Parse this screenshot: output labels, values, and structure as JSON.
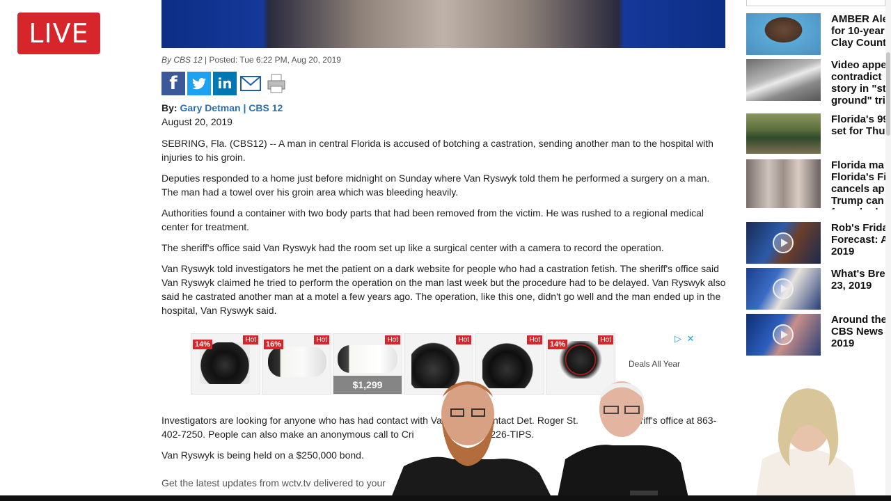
{
  "live_label": "LIVE",
  "article": {
    "meta_source": "By CBS 12",
    "meta_posted": "| Posted: Tue 6:22 PM, Aug 20, 2019",
    "by_label": "By:",
    "author": "Gary Detman | CBS 12",
    "date": "August 20, 2019",
    "paragraphs": [
      "SEBRING, Fla. (CBS12) -- A man in central Florida is accused of botching a castration, sending another man to the hospital with injuries to his groin.",
      "Deputies responded to a home just before midnight on Sunday where Van Ryswyk told them he performed a surgery on a man. The man had a towel over his groin area which was bleeding heavily.",
      "Authorities found a container with two body parts that had been removed from the victim. He was rushed to a regional medical center for treatment.",
      "The sheriff's office said Van Ryswyk had the room set up like a surgical center with a camera to record the operation.",
      "Van Ryswyk told investigators he met the patient on a dark website for people who had a castration fetish. The sheriff's office said Van Ryswyk claimed he tried to perform the operation on the man last week but the procedure had to be delayed. Van Ryswyk also said he castrated another man at a motel a few years ago. The operation, like this one, didn't go well and the man ended up in the hospital, Van Ryswyk said."
    ],
    "paragraphs_after_ad": [
      "Investigators are looking for anyone who has had contact with Va           to contact Det. Roger St.         t the sheriff's office at 863-402-7250. People can also make an anonymous call to Cri           ers at 800-226-TIPS.",
      "Van Ryswyk is being held on a $250,000 bond."
    ],
    "latest": "Get the latest updates from wctv.tv delivered to your"
  },
  "ad": {
    "hot_label": "Hot",
    "cards": [
      {
        "discount": "14%",
        "price": ""
      },
      {
        "discount": "16%",
        "price": ""
      },
      {
        "discount": "",
        "price": "$1,299"
      },
      {
        "discount": "",
        "price": ""
      },
      {
        "discount": "",
        "price": ""
      },
      {
        "discount": "14%",
        "price": ""
      }
    ],
    "deals_text": "Deals All Year",
    "adchoices_icon": "adchoices-icon",
    "close_icon": "close-icon"
  },
  "share_icons": [
    "facebook-icon",
    "twitter-icon",
    "linkedin-icon",
    "email-icon",
    "print-icon"
  ],
  "sidebar": [
    {
      "title": "AMBER Ale for 10-year Clay Count",
      "video": false
    },
    {
      "title": "Video appe contradict story in \"st ground\" tri",
      "video": false
    },
    {
      "title": "Florida's 99 set for Thu",
      "video": false
    },
    {
      "title": "Florida ma Florida's Fi cancels ap Trump can for schedu",
      "video": false
    },
    {
      "title": "Rob's Frida Forecast: A 2019",
      "video": true
    },
    {
      "title": "What's Bre 23, 2019",
      "video": true
    },
    {
      "title": "Around the CBS News 2019",
      "video": true
    }
  ],
  "colors": {
    "live_red": "#d7262b",
    "link_blue": "#2a6fb0",
    "facebook": "#3b5998",
    "twitter": "#1da1f2",
    "linkedin": "#0077b5"
  }
}
